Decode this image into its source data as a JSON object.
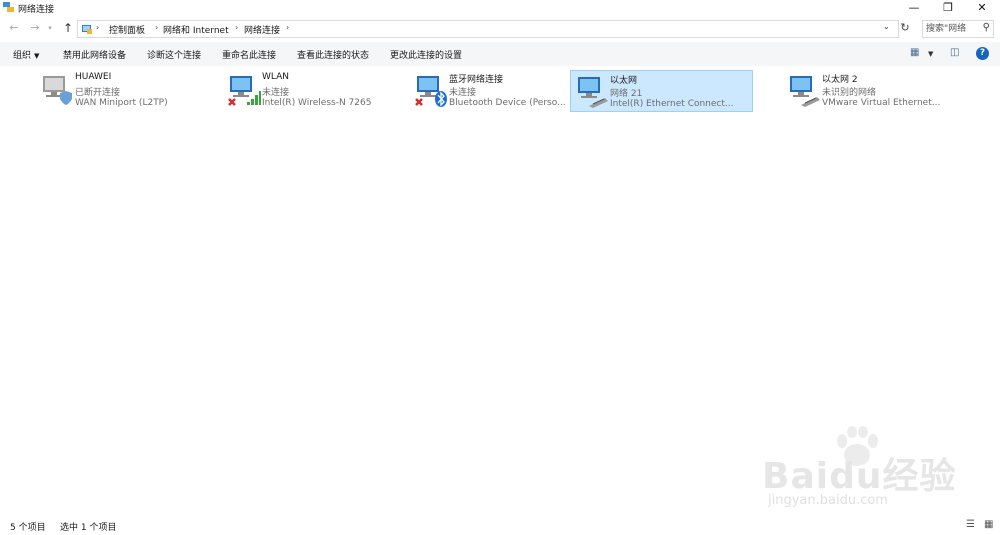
{
  "window": {
    "title": "网络连接"
  },
  "address": {
    "crumbs": [
      "控制面板",
      "网络和 Internet",
      "网络连接"
    ]
  },
  "search": {
    "placeholder": "搜索\"网络"
  },
  "toolbar": {
    "organize": "组织",
    "disable": "禁用此网络设备",
    "diagnose": "诊断这个连接",
    "rename": "重命名此连接",
    "view_status": "查看此连接的状态",
    "change_settings": "更改此连接的设置"
  },
  "connections": [
    {
      "name": "HUAWEI",
      "status": "已断开连接",
      "device": "WAN Miniport (L2TP)",
      "badge": "shield",
      "selected": false
    },
    {
      "name": "WLAN",
      "status": "未连接",
      "device": "Intel(R) Wireless-N 7265",
      "badge": "wifi-disconnected",
      "selected": false
    },
    {
      "name": "蓝牙网络连接",
      "status": "未连接",
      "device": "Bluetooth Device (Perso...",
      "badge": "bluetooth-disconnected",
      "selected": false
    },
    {
      "name": "以太网",
      "status": "网络  21",
      "device": "Intel(R) Ethernet Connect...",
      "badge": "ethernet",
      "selected": true
    },
    {
      "name": "以太网 2",
      "status": "未识别的网络",
      "device": "VMware Virtual Ethernet...",
      "badge": "ethernet",
      "selected": false
    }
  ],
  "statusbar": {
    "count": "5 个项目",
    "selected": "选中 1 个项目"
  },
  "watermark": {
    "main": "Baidu经验",
    "sub": "jingyan.baidu.com"
  },
  "colors": {
    "selection_bg": "#cce8ff",
    "selection_border": "#99d1ff",
    "help": "#1565c0",
    "cmdbar": "#f5f6f7"
  }
}
